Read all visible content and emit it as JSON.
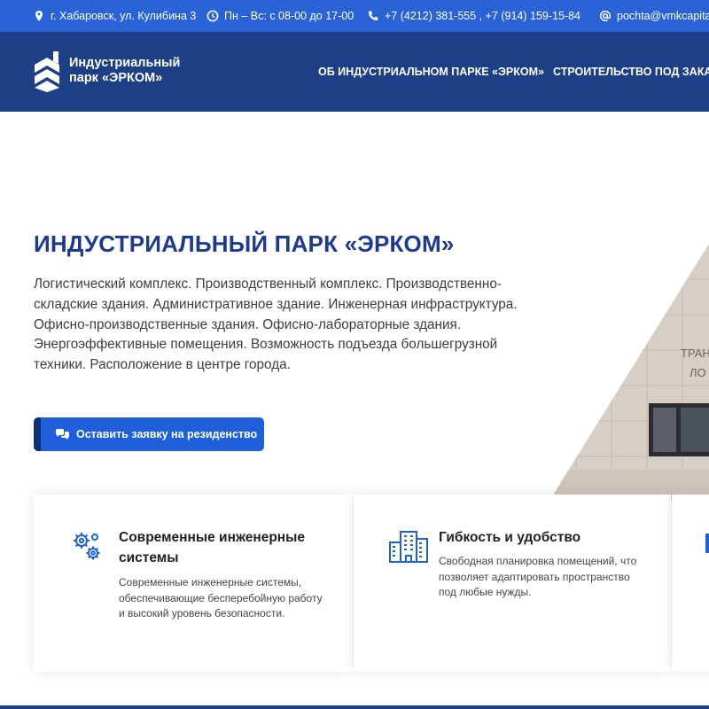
{
  "topbar": {
    "address": "г. Хабаровск, ул. Кулибина 3",
    "hours": "Пн – Вс: с 08-00 до 17-00",
    "phones": "+7 (4212) 381-555 ,  +7 (914) 159-15-84",
    "email": "pochta@vmkcapital.ru"
  },
  "header": {
    "logo_line1": "Индустриальный",
    "logo_line2": "парк «ЭРКОМ»",
    "nav": [
      "ОБ ИНДУСТРИАЛЬНОМ ПАРКЕ «ЭРКОМ»",
      "СТРОИТЕЛЬСТВО ПОД ЗАКАЗ"
    ]
  },
  "hero": {
    "title": "ИНДУСТРИАЛЬНЫЙ ПАРК «ЭРКОМ»",
    "description": "Логистический комплекс. Производственный комплекс. Производственно-складские здания. Административное здание. Инженерная инфраструктура. Офисно-производственные здания. Офисно-лабораторные здания. Энергоэффективные помещения. Возможность подъезда большегрузной техники. Расположение в центре города.",
    "cta_label": "Оставить заявку на резиденство",
    "photo_sign": [
      "ТРАН",
      "ЛО"
    ]
  },
  "features": [
    {
      "icon": "gears-icon",
      "title": "Современные инженерные системы",
      "text": "Современные инженерные системы, обеспечивающие бесперебойную работу и высокий уровень безопасности."
    },
    {
      "icon": "buildings-icon",
      "title": "Гибкость и удобство",
      "text": "Свободная планировка помещений, что позволяет адаптировать пространство под любые нужды."
    }
  ],
  "colors": {
    "topbar": "#2a63d6",
    "header": "#1d3f86",
    "accent": "#1f5fd9",
    "title": "#1e3a8a"
  }
}
